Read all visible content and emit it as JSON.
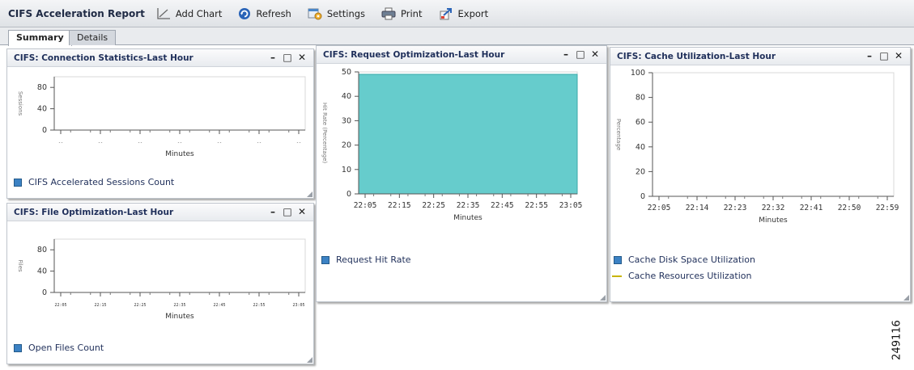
{
  "toolbar": {
    "title": "CIFS Acceleration Report",
    "add_chart": "Add Chart",
    "refresh": "Refresh",
    "settings": "Settings",
    "print": "Print",
    "export": "Export"
  },
  "tabs": [
    {
      "label": "Summary",
      "active": true
    },
    {
      "label": "Details",
      "active": false
    }
  ],
  "panel_controls": {
    "minimize": "–",
    "maximize": "□",
    "close": "✕"
  },
  "colors": {
    "series_fill": "#66cccc",
    "legend_blue": "#3c82c4",
    "legend_line": "#c8b400",
    "title_blue": "#1f2f5a"
  },
  "panels": [
    {
      "title": "CIFS: Connection Statistics-Last Hour",
      "xlabel": "Minutes",
      "ylabel": "Sessions",
      "legend": [
        {
          "label": "CIFS Accelerated Sessions Count",
          "kind": "box"
        }
      ],
      "chart_data": {
        "type": "line",
        "yticks": [
          0,
          40,
          80
        ],
        "ylim": [
          0,
          100
        ],
        "xticks": [
          "--",
          "--",
          "--",
          "--",
          "--",
          "--",
          "--"
        ],
        "series": [
          {
            "name": "CIFS Accelerated Sessions Count",
            "values": []
          }
        ]
      }
    },
    {
      "title": "CIFS: File Optimization-Last Hour",
      "xlabel": "Minutes",
      "ylabel": "Files",
      "legend": [
        {
          "label": "Open Files Count",
          "kind": "box"
        }
      ],
      "chart_data": {
        "type": "line",
        "yticks": [
          0,
          40,
          80
        ],
        "ylim": [
          0,
          100
        ],
        "xticks": [
          "22:05",
          "22:15",
          "22:25",
          "22:35",
          "22:45",
          "22:55",
          "23:05"
        ],
        "series": [
          {
            "name": "Open Files Count",
            "values": []
          }
        ]
      }
    },
    {
      "title": "CIFS: Request Optimization-Last Hour",
      "xlabel": "Minutes",
      "ylabel": "Hit Rate (Percentage)",
      "legend": [
        {
          "label": "Request Hit Rate",
          "kind": "box"
        }
      ],
      "chart_data": {
        "type": "area",
        "yticks": [
          0,
          10,
          20,
          30,
          40,
          50
        ],
        "ylim": [
          0,
          50
        ],
        "xticks": [
          "22:05",
          "22:15",
          "22:25",
          "22:35",
          "22:45",
          "22:55",
          "23:05"
        ],
        "series": [
          {
            "name": "Request Hit Rate",
            "values": [
              49,
              49,
              49,
              49,
              49,
              49,
              49
            ]
          }
        ]
      }
    },
    {
      "title": "CIFS: Cache Utilization-Last Hour",
      "xlabel": "Minutes",
      "ylabel": "Percentage",
      "legend": [
        {
          "label": "Cache Disk Space Utilization",
          "kind": "box"
        },
        {
          "label": "Cache Resources Utilization",
          "kind": "line"
        }
      ],
      "chart_data": {
        "type": "line",
        "yticks": [
          0,
          20,
          40,
          60,
          80,
          100
        ],
        "ylim": [
          0,
          100
        ],
        "xticks": [
          "22:05",
          "22:14",
          "22:23",
          "22:32",
          "22:41",
          "22:50",
          "22:59"
        ],
        "series": [
          {
            "name": "Cache Disk Space Utilization",
            "values": []
          },
          {
            "name": "Cache Resources Utilization",
            "values": []
          }
        ]
      }
    }
  ],
  "figure_id": "249116"
}
